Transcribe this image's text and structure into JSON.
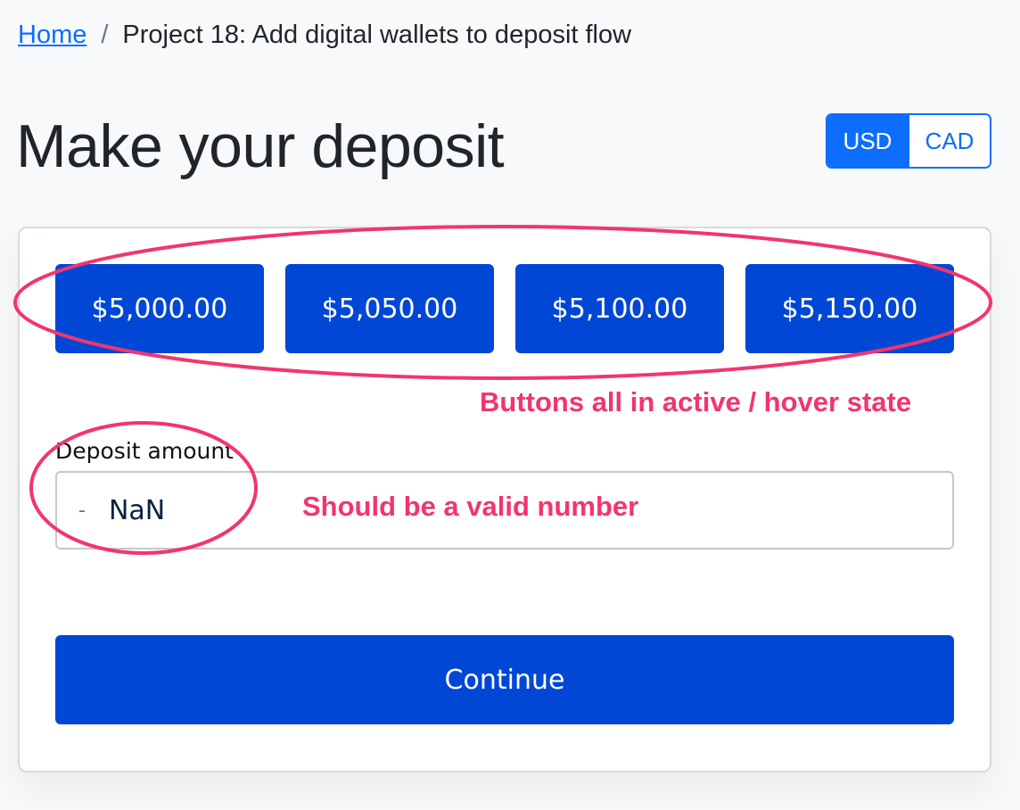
{
  "breadcrumb": {
    "home": "Home",
    "separator": "/",
    "current": "Project 18: Add digital wallets to deposit flow"
  },
  "page": {
    "title": "Make your deposit"
  },
  "currency": {
    "options": [
      "USD",
      "CAD"
    ],
    "selected": "USD"
  },
  "amount_buttons": [
    "$5,000.00",
    "$5,050.00",
    "$5,100.00",
    "$5,150.00"
  ],
  "deposit": {
    "label": "Deposit amount",
    "prefix": "-",
    "value": "NaN"
  },
  "continue_label": "Continue",
  "annotations": {
    "buttons_note": "Buttons all in active / hover state",
    "input_note": "Should be a valid number"
  },
  "colors": {
    "primary": "#0d6efd",
    "button_active": "#0047d6",
    "annotation": "#f2356d",
    "background": "#f8f9fa"
  }
}
